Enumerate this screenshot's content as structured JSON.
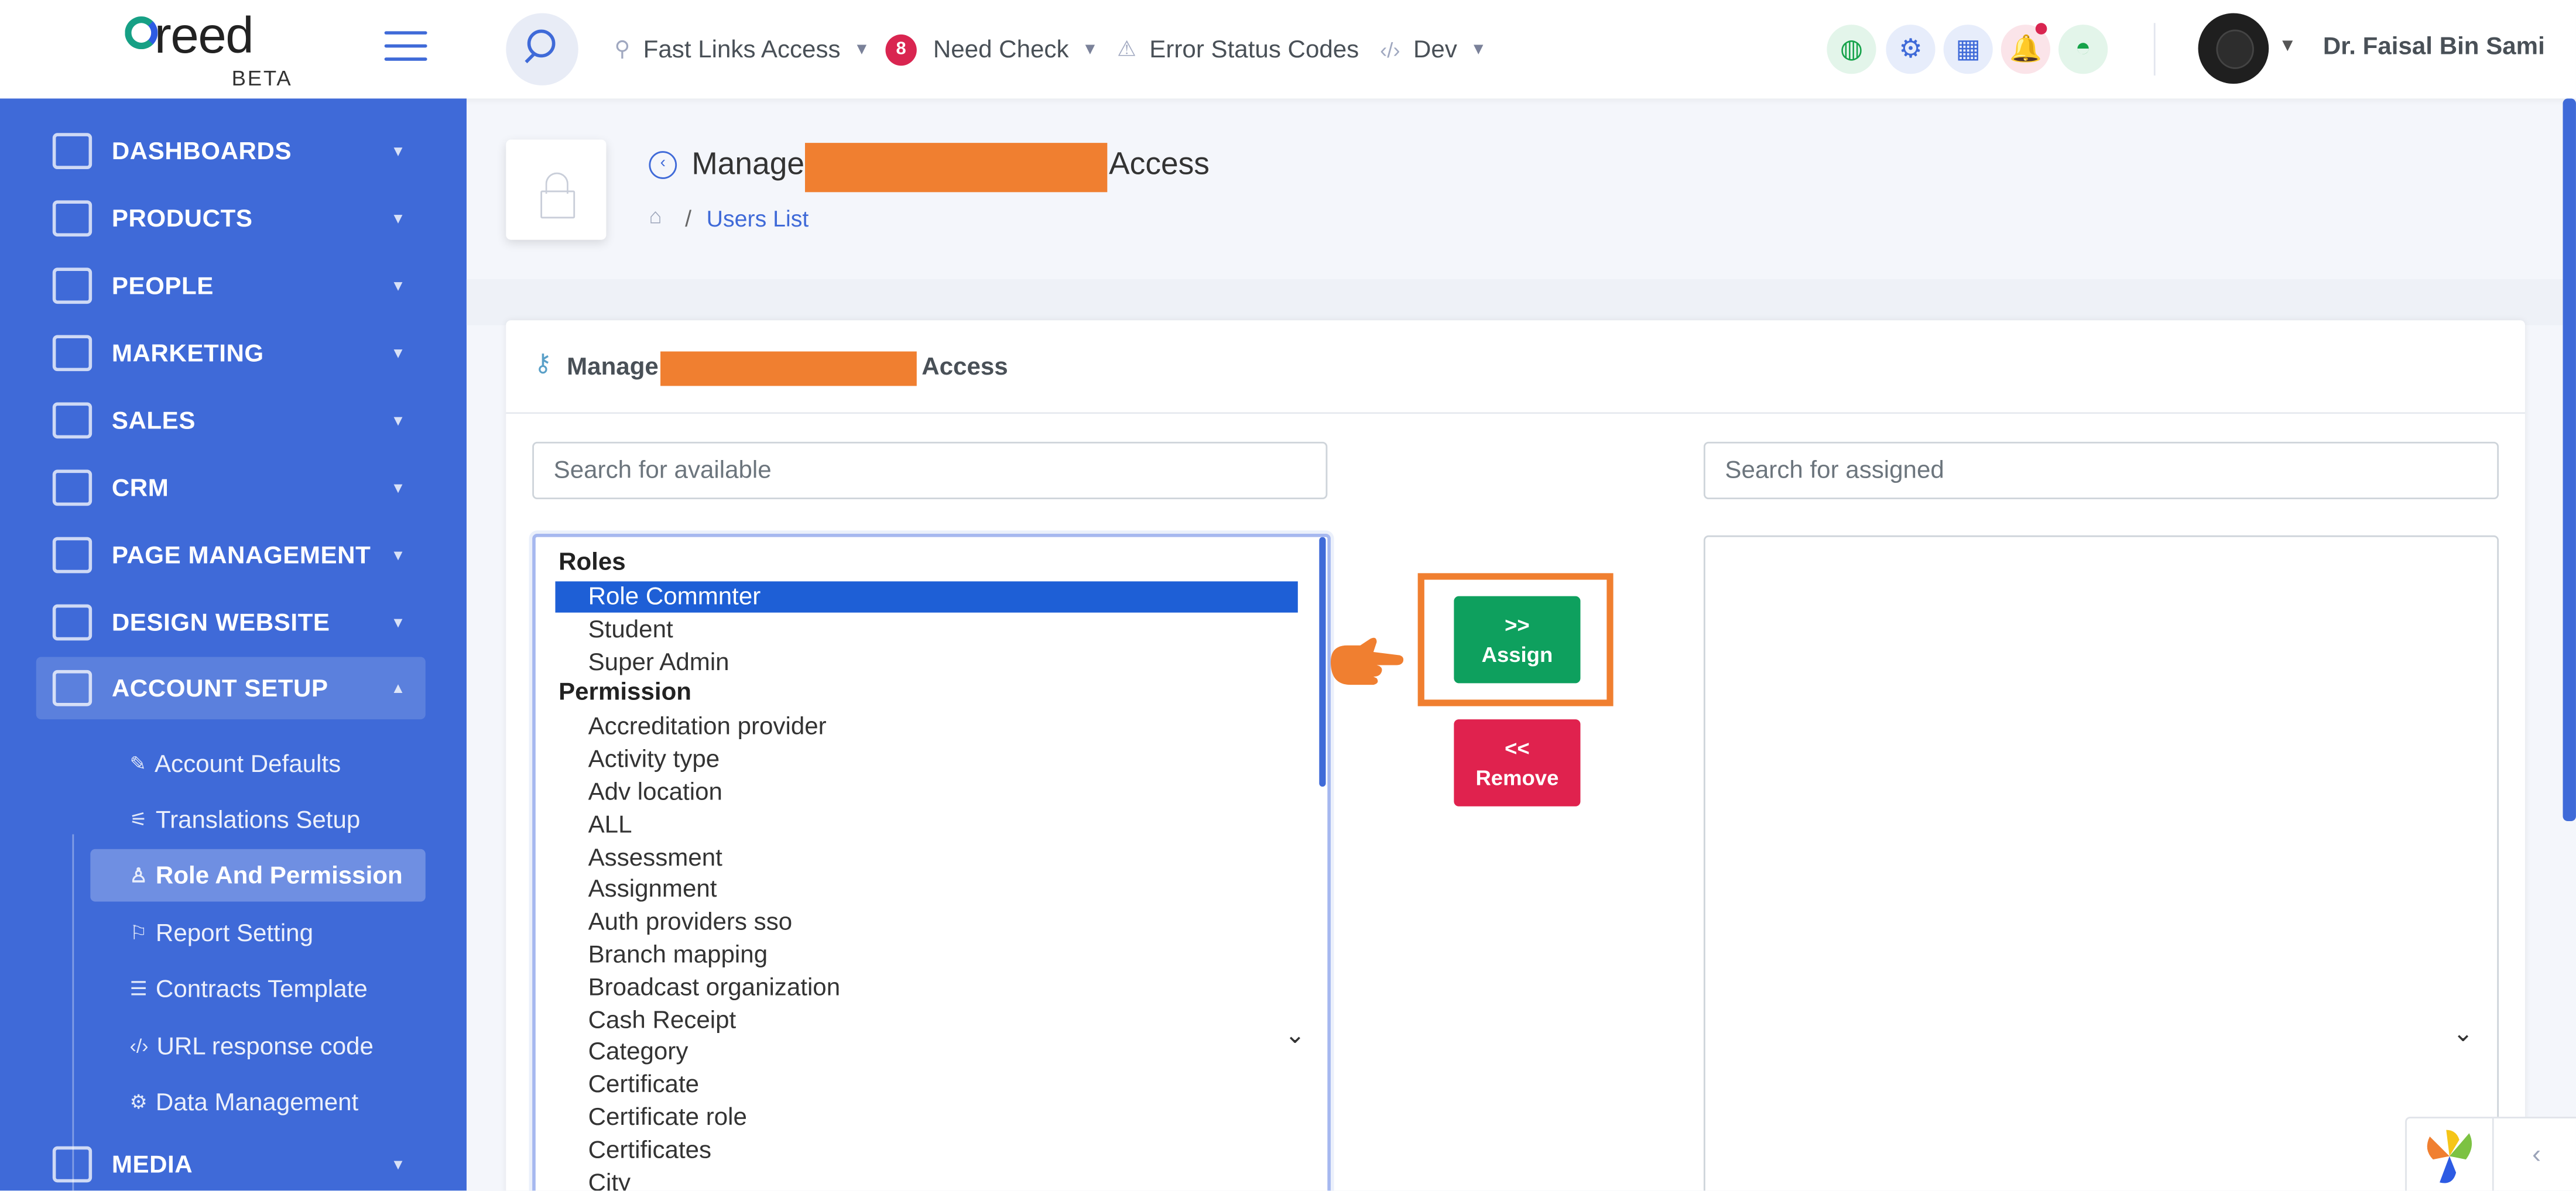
{
  "header": {
    "logo_text": "reed",
    "logo_sub": "BETA",
    "nav": [
      {
        "label": "Fast Links Access"
      },
      {
        "label": "Need Check",
        "badge": "8"
      },
      {
        "label": "Error Status Codes"
      },
      {
        "label": "Dev"
      }
    ],
    "icons": [
      "globe-icon",
      "gear-icon",
      "grid-icon",
      "bell-icon",
      "image-icon"
    ],
    "user_name": "Dr. Faisal Bin Sami"
  },
  "sidebar": {
    "items": [
      {
        "label": "DASHBOARDS",
        "icon": "bar-chart-icon"
      },
      {
        "label": "PRODUCTS",
        "icon": "box-icon"
      },
      {
        "label": "PEOPLE",
        "icon": "people-icon"
      },
      {
        "label": "MARKETING",
        "icon": "mail-icon"
      },
      {
        "label": "SALES",
        "icon": "money-icon"
      },
      {
        "label": "CRM",
        "icon": "monitor-icon"
      },
      {
        "label": "PAGE MANAGEMENT",
        "icon": "pages-icon"
      },
      {
        "label": "DESIGN WEBSITE",
        "icon": "paint-roller-icon"
      },
      {
        "label": "ACCOUNT SETUP",
        "icon": "tools-icon"
      },
      {
        "label": "MEDIA",
        "icon": "music-icon"
      }
    ],
    "sub_items": [
      {
        "label": "Account Defaults",
        "icon": "pencil-icon"
      },
      {
        "label": "Translations Setup",
        "icon": "chart-icon"
      },
      {
        "label": "Role And Permission",
        "icon": "user-icon"
      },
      {
        "label": "Report Setting",
        "icon": "flag-icon"
      },
      {
        "label": "Contracts Template",
        "icon": "list-icon"
      },
      {
        "label": "URL response code",
        "icon": "code-icon"
      },
      {
        "label": "Data Management",
        "icon": "gear-icon"
      }
    ]
  },
  "page": {
    "title_start": "Manage",
    "title_end": "Access",
    "breadcrumb": "Users List"
  },
  "card": {
    "title_start": "Manage",
    "title_end": "Access",
    "search_available_placeholder": "Search for available",
    "search_assigned_placeholder": "Search for assigned",
    "groups": [
      {
        "label": "Roles",
        "options": [
          "Role Commnter",
          "Student",
          "Super Admin"
        ]
      },
      {
        "label": "Permission",
        "options": [
          "Accreditation provider",
          "Activity type",
          "Adv location",
          "ALL",
          "Assessment",
          "Assignment",
          "Auth providers sso",
          "Branch mapping",
          "Broadcast organization",
          "Cash Receipt",
          "Category",
          "Certificate",
          "Certificate role",
          "Certificates",
          "City"
        ]
      }
    ],
    "selected_option": "Role Commnter",
    "assign_arrows": ">>",
    "assign_label": "Assign",
    "remove_arrows": "<<",
    "remove_label": "Remove"
  },
  "colors": {
    "sidebar": "#3f6ad8",
    "assign": "#0ea05e",
    "remove": "#e0224e",
    "highlight": "#f07f30",
    "selected": "#1e5fd6"
  }
}
